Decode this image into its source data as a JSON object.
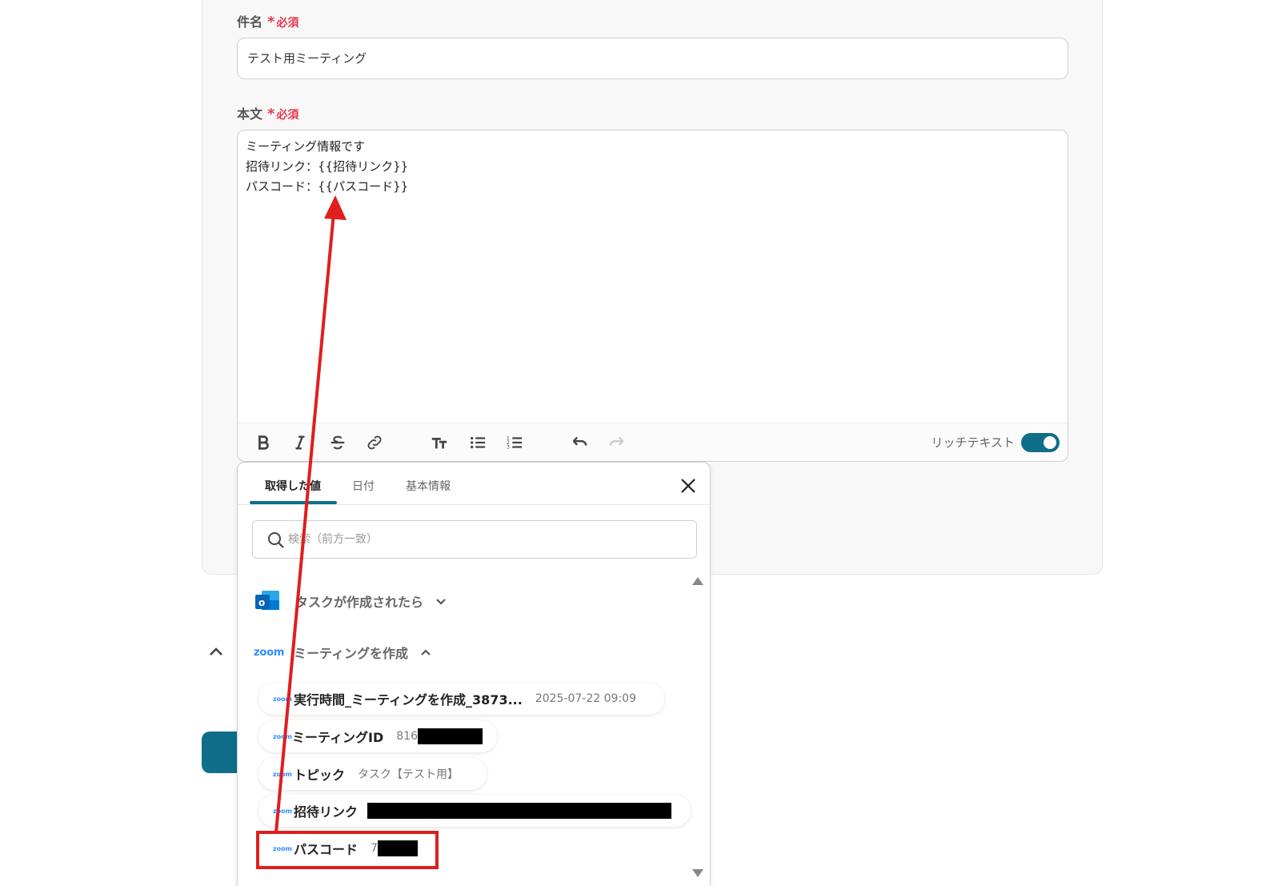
{
  "form": {
    "subject": {
      "label": "件名",
      "required": "必須",
      "required_mark": "*",
      "value": "テスト用ミーティング"
    },
    "body": {
      "label": "本文",
      "required": "必須",
      "required_mark": "*",
      "lines": [
        "ミーティング情報です",
        "招待リンク：{{招待リンク}}",
        "パスコード：{{パスコード}}"
      ]
    },
    "toolbar": {
      "buttons": [
        "bold-icon",
        "italic-icon",
        "strikethrough-icon",
        "link-icon",
        "text-size-icon",
        "bullet-list-icon",
        "numbered-list-icon",
        "undo-icon",
        "redo-icon"
      ],
      "rich_text_label": "リッチテキスト",
      "rich_text_enabled": true
    }
  },
  "popup": {
    "tabs": [
      {
        "label": "取得した値",
        "active": true
      },
      {
        "label": "日付",
        "active": false
      },
      {
        "label": "基本情報",
        "active": false
      }
    ],
    "search_placeholder": "検索（前方一致）",
    "sections": [
      {
        "app": "outlook",
        "title": "タスクが作成されたら",
        "expanded": false
      },
      {
        "app": "zoom",
        "logo_text": "zoom",
        "title": "ミーティングを作成",
        "expanded": true
      }
    ],
    "items": [
      {
        "app_logo": "zoom",
        "title": "実行時間_ミーティングを作成_3873...",
        "value": "2025-07-22 09:09",
        "redacted": false
      },
      {
        "app_logo": "zoom",
        "title": "ミーティングID",
        "value": "816",
        "redacted": true
      },
      {
        "app_logo": "zoom",
        "title": "トピック",
        "value": "タスク【テスト用】",
        "redacted": false
      },
      {
        "app_logo": "zoom",
        "title": "招待リンク",
        "value": "",
        "redacted": true
      },
      {
        "app_logo": "zoom",
        "title": "パスコード",
        "value": "7",
        "redacted": true
      }
    ]
  },
  "annotation": {
    "highlight_color": "#e01e1e",
    "arrow_color": "#e01e1e"
  },
  "colors": {
    "accent": "#0f6e8a",
    "required": "#e8384f",
    "zoom": "#2d8cff"
  }
}
